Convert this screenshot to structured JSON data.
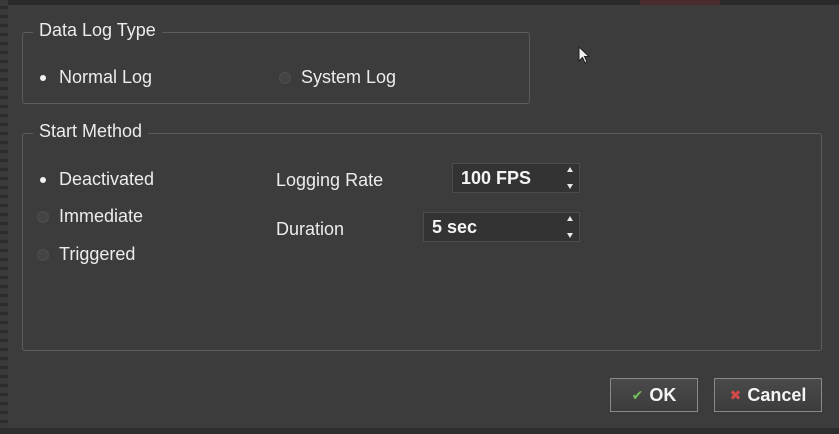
{
  "data_log_type": {
    "title": "Data Log Type",
    "options": [
      {
        "label": "Normal Log",
        "selected": true
      },
      {
        "label": "System Log",
        "selected": false
      }
    ]
  },
  "start_method": {
    "title": "Start Method",
    "options": [
      {
        "label": "Deactivated",
        "selected": true
      },
      {
        "label": "Immediate",
        "selected": false
      },
      {
        "label": "Triggered",
        "selected": false
      }
    ],
    "logging_rate": {
      "label": "Logging Rate",
      "value": "100 FPS"
    },
    "duration": {
      "label": "Duration",
      "value": "5 sec"
    }
  },
  "buttons": {
    "ok_label": "OK",
    "cancel_label": "Cancel"
  },
  "colors": {
    "background": "#3c3c3c",
    "ok_accent": "#6fbf5a",
    "cancel_accent": "#d24b4b"
  },
  "icons": {
    "ok": "checkmark-icon",
    "cancel": "x-icon",
    "spin": "up-down-arrows-icon",
    "cursor": "mouse-pointer-icon"
  }
}
